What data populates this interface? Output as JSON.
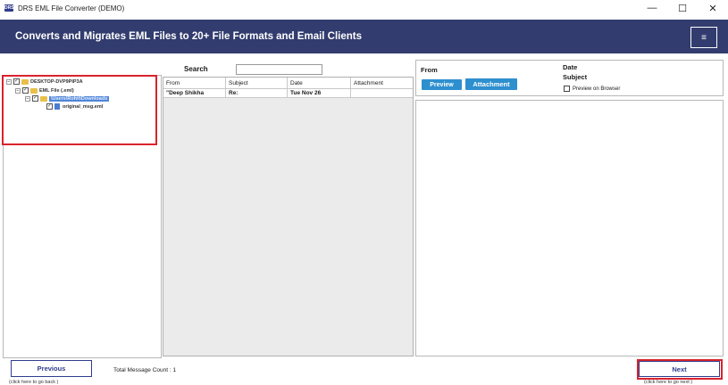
{
  "window": {
    "title": "DRS EML File Converter (DEMO)",
    "controls": [
      "minimize",
      "maximize",
      "close"
    ]
  },
  "banner": {
    "title": "Converts and Migrates EML Files to 20+ File Formats and Email Clients",
    "menu_icon": "hamburger-icon"
  },
  "tree": {
    "items": [
      {
        "label": "DESKTOP-DVP9PIP3A",
        "checked": true,
        "icon": "computer-icon"
      },
      {
        "label": "EML File (.eml)",
        "checked": true,
        "icon": "folder-icon"
      },
      {
        "label": "\\Users\\Rohit\\Downloads",
        "checked": true,
        "icon": "folder-icon",
        "selected": true
      },
      {
        "label": "original_msg.eml",
        "checked": true,
        "icon": "file-icon"
      }
    ]
  },
  "search": {
    "label": "Search",
    "value": ""
  },
  "mail_table": {
    "columns": [
      "From",
      "Subject",
      "Date",
      "Attachment"
    ],
    "rows": [
      {
        "from": "\"Deep Shikha",
        "subject": "Re:",
        "date": "Tue Nov 26",
        "attachment": ""
      }
    ]
  },
  "preview": {
    "from_label": "From",
    "date_label": "Date",
    "subject_label": "Subject",
    "preview_button": "Preview",
    "attachment_button": "Attachment",
    "browser_checkbox_label": "Preview on Browser",
    "browser_checked": false
  },
  "footer": {
    "previous_label": "Previous",
    "previous_hint": "(click here to  go back )",
    "total_count": "Total Message Count : 1",
    "next_label": "Next",
    "next_hint": "(click here to  go next )"
  },
  "colors": {
    "banner": "#323c6e",
    "accent_button": "#2e8fcf",
    "highlight_box": "#d9232d"
  }
}
